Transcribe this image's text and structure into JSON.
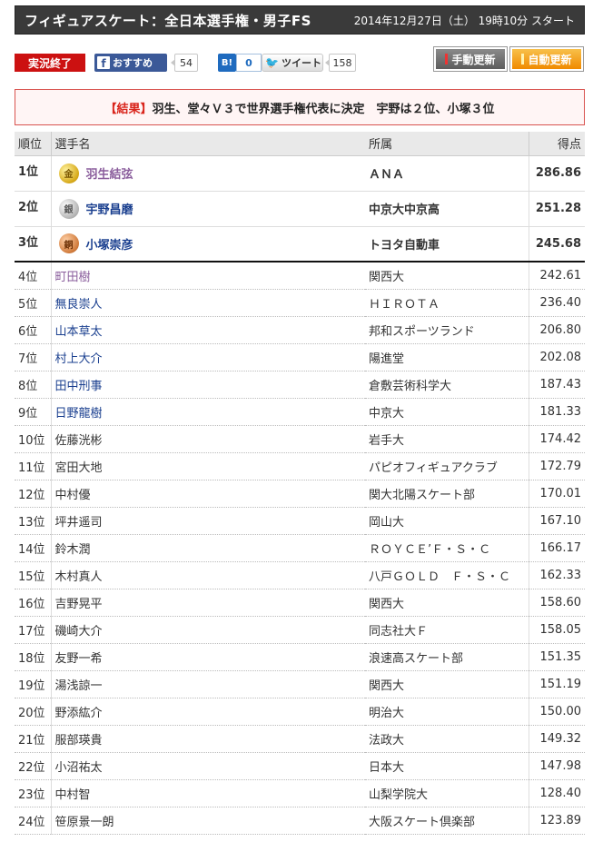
{
  "header": {
    "title": "フィギュアスケート：全日本選手権・男子FS",
    "datetime": "2014年12月27日（土） 19時10分 スタート"
  },
  "toolbar": {
    "status_label": "実況終了",
    "facebook_label": "おすすめ",
    "facebook_count": "54",
    "hatena_label": "B!",
    "hatena_count": "0",
    "tweet_label": "ツイート",
    "tweet_count": "158",
    "manual_update_label": "手動更新",
    "auto_update_label": "自動更新"
  },
  "result": {
    "tag": "【結果】",
    "text": "羽生、堂々Ｖ３で世界選手権代表に決定　宇野は２位、小塚３位"
  },
  "table": {
    "headers": {
      "rank": "順位",
      "name": "選手名",
      "team": "所属",
      "score": "得点"
    },
    "top3": [
      {
        "rank": "1位",
        "medal": "金",
        "name": "羽生結弦",
        "team": "ＡＮＡ",
        "score": "286.86",
        "link": "purple"
      },
      {
        "rank": "2位",
        "medal": "銀",
        "name": "宇野昌磨",
        "team": "中京大中京高",
        "score": "251.28",
        "link": "blue"
      },
      {
        "rank": "3位",
        "medal": "銅",
        "name": "小塚崇彦",
        "team": "トヨタ自動車",
        "score": "245.68",
        "link": "blue"
      }
    ],
    "rows": [
      {
        "rank": "4位",
        "name": "町田樹",
        "team": "関西大",
        "score": "242.61",
        "link": "purple"
      },
      {
        "rank": "5位",
        "name": "無良崇人",
        "team": "ＨＩＲＯＴＡ",
        "score": "236.40",
        "link": "blue"
      },
      {
        "rank": "6位",
        "name": "山本草太",
        "team": "邦和スポーツランド",
        "score": "206.80",
        "link": "blue"
      },
      {
        "rank": "7位",
        "name": "村上大介",
        "team": "陽進堂",
        "score": "202.08",
        "link": "blue"
      },
      {
        "rank": "8位",
        "name": "田中刑事",
        "team": "倉敷芸術科学大",
        "score": "187.43",
        "link": "blue"
      },
      {
        "rank": "9位",
        "name": "日野龍樹",
        "team": "中京大",
        "score": "181.33",
        "link": "blue"
      },
      {
        "rank": "10位",
        "name": "佐藤洸彬",
        "team": "岩手大",
        "score": "174.42",
        "link": "plain"
      },
      {
        "rank": "11位",
        "name": "宮田大地",
        "team": "パピオフィギュアクラブ",
        "score": "172.79",
        "link": "plain"
      },
      {
        "rank": "12位",
        "name": "中村優",
        "team": "関大北陽スケート部",
        "score": "170.01",
        "link": "plain"
      },
      {
        "rank": "13位",
        "name": "坪井遥司",
        "team": "岡山大",
        "score": "167.10",
        "link": "plain"
      },
      {
        "rank": "14位",
        "name": "鈴木潤",
        "team": "ＲＯＹＣＥ’Ｆ・Ｓ・Ｃ",
        "score": "166.17",
        "link": "plain"
      },
      {
        "rank": "15位",
        "name": "木村真人",
        "team": "八戸ＧＯＬＤ　Ｆ・Ｓ・Ｃ",
        "score": "162.33",
        "link": "plain"
      },
      {
        "rank": "16位",
        "name": "吉野晃平",
        "team": "関西大",
        "score": "158.60",
        "link": "plain"
      },
      {
        "rank": "17位",
        "name": "磯崎大介",
        "team": "同志社大Ｆ",
        "score": "158.05",
        "link": "plain"
      },
      {
        "rank": "18位",
        "name": "友野一希",
        "team": "浪速高スケート部",
        "score": "151.35",
        "link": "plain"
      },
      {
        "rank": "19位",
        "name": "湯浅諒一",
        "team": "関西大",
        "score": "151.19",
        "link": "plain"
      },
      {
        "rank": "20位",
        "name": "野添紘介",
        "team": "明治大",
        "score": "150.00",
        "link": "plain"
      },
      {
        "rank": "21位",
        "name": "服部瑛貴",
        "team": "法政大",
        "score": "149.32",
        "link": "plain"
      },
      {
        "rank": "22位",
        "name": "小沼祐太",
        "team": "日本大",
        "score": "147.98",
        "link": "plain"
      },
      {
        "rank": "23位",
        "name": "中村智",
        "team": "山梨学院大",
        "score": "128.40",
        "link": "plain"
      },
      {
        "rank": "24位",
        "name": "笹原景一朗",
        "team": "大阪スケート倶楽部",
        "score": "123.89",
        "link": "plain"
      }
    ]
  }
}
